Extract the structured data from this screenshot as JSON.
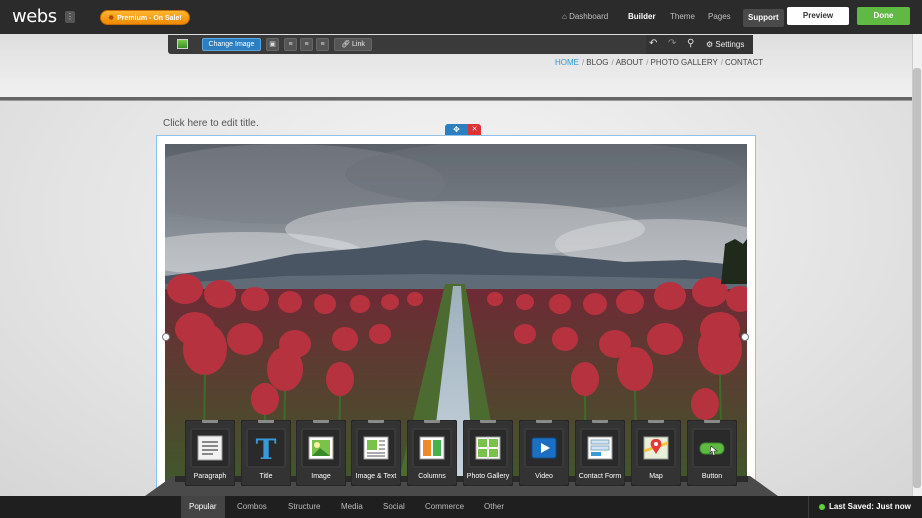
{
  "topbar": {
    "logo": "webs",
    "premium_badge": "Premium - On Sale!",
    "nav": {
      "dashboard": "Dashboard",
      "builder": "Builder",
      "theme": "Theme",
      "pages": "Pages",
      "support": "Support"
    },
    "preview": "Preview",
    "done": "Done"
  },
  "image_toolbar": {
    "change_image": "Change Image",
    "link": "Link",
    "settings": "Settings"
  },
  "site_nav": [
    "HOME",
    "BLOG",
    "ABOUT",
    "PHOTO GALLERY",
    "CONTACT"
  ],
  "page": {
    "title_placeholder": "Click here to edit title."
  },
  "elements": [
    {
      "label": "Paragraph",
      "icon": "paragraph-icon"
    },
    {
      "label": "Title",
      "icon": "title-icon"
    },
    {
      "label": "Image",
      "icon": "image-icon"
    },
    {
      "label": "Image & Text",
      "icon": "image-text-icon"
    },
    {
      "label": "Columns",
      "icon": "columns-icon"
    },
    {
      "label": "Photo Gallery",
      "icon": "photo-gallery-icon"
    },
    {
      "label": "Video",
      "icon": "video-icon"
    },
    {
      "label": "Contact Form",
      "icon": "contact-form-icon"
    },
    {
      "label": "Map",
      "icon": "map-icon"
    },
    {
      "label": "Button",
      "icon": "button-icon"
    }
  ],
  "bottom_tabs": [
    "Popular",
    "Combos",
    "Structure",
    "Media",
    "Social",
    "Commerce",
    "Other"
  ],
  "active_tab": "Popular",
  "save_status": "Last Saved: Just now",
  "colors": {
    "accent_blue": "#2c7fc1",
    "done_green": "#5fb942",
    "premium_orange": "#f5a01a"
  }
}
